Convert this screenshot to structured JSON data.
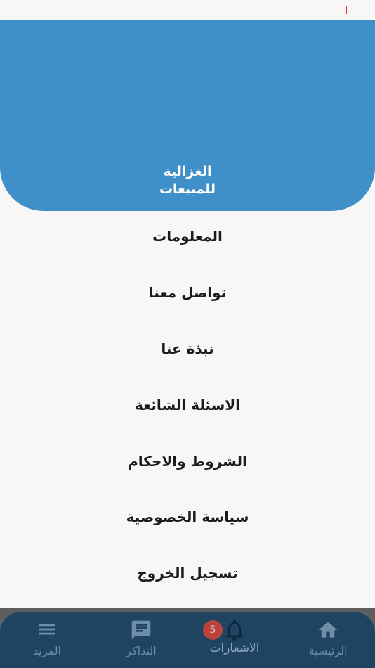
{
  "status_bar": {
    "left_text": "",
    "center_text": "",
    "right_text": ""
  },
  "header": {
    "title_line1": "الغزالية",
    "title_line2": "للمبيعات",
    "color": "#3f8fc9"
  },
  "menu": {
    "items": [
      {
        "label": "المعلومات"
      },
      {
        "label": "تواصل معنا"
      },
      {
        "label": "نبذة عنا"
      },
      {
        "label": "الاسئلة الشائعة"
      },
      {
        "label": "الشروط والاحكام"
      },
      {
        "label": "سياسة الخصوصية"
      },
      {
        "label": "تسجيل الخروج"
      }
    ]
  },
  "bottom_nav": {
    "background": "#1e4462",
    "items": [
      {
        "label": "المزيد",
        "icon": "menu-icon"
      },
      {
        "label": "التذاكر",
        "icon": "chat-icon"
      },
      {
        "label": "الاشعارات",
        "icon": "bell-icon",
        "badge": "5",
        "active": true
      },
      {
        "label": "الرئيسية",
        "icon": "home-icon"
      }
    ]
  }
}
